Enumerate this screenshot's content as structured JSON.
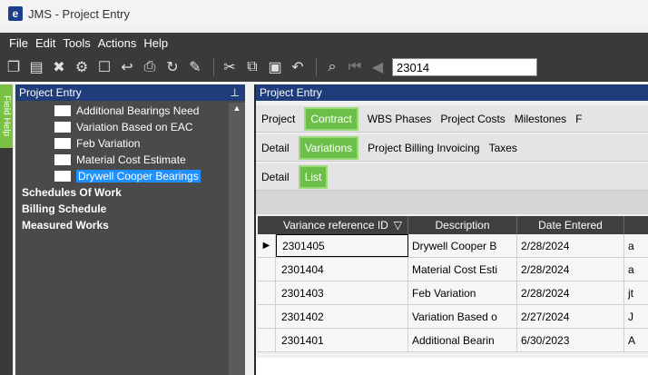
{
  "window": {
    "title": "JMS - Project Entry",
    "logo": "e"
  },
  "menu": [
    "File",
    "Edit",
    "Tools",
    "Actions",
    "Help"
  ],
  "toolbar": {
    "icons": [
      "new-icon",
      "save-icon",
      "delete-icon",
      "tools-icon",
      "blank-icon",
      "undo-arrow-icon",
      "print-icon",
      "refresh-icon",
      "clear-icon",
      "cut-icon",
      "copy-icon",
      "paste-icon",
      "undo-icon",
      "find-icon",
      "first-record-icon",
      "previous-record-icon"
    ],
    "record_value": "23014"
  },
  "side": {
    "field_help": "Field Help"
  },
  "nav": {
    "title": "Project Entry",
    "pin": "⊥",
    "sub_items": [
      {
        "label": "Additional Bearings Need"
      },
      {
        "label": "Variation Based on EAC"
      },
      {
        "label": "Feb Variation"
      },
      {
        "label": "Material Cost Estimate"
      },
      {
        "label": "Drywell Cooper Bearings"
      }
    ],
    "top_items": [
      {
        "label": "Schedules Of Work"
      },
      {
        "label": "Billing Schedule"
      },
      {
        "label": "Measured Works"
      }
    ]
  },
  "main": {
    "title": "Project Entry",
    "tabs_level1": [
      "Project",
      "Contract",
      "WBS Phases",
      "Project Costs",
      "Milestones",
      "F"
    ],
    "tabs_level2": [
      "Detail",
      "Variations",
      "Project Billing Invoicing",
      "Taxes"
    ],
    "tabs_level3": [
      "Detail",
      "List"
    ]
  },
  "grid": {
    "columns": {
      "id": "Variance reference ID",
      "filter": "▽",
      "desc": "Description",
      "date": "Date Entered"
    },
    "rows": [
      {
        "marker": "▶",
        "id": "2301405",
        "desc": "Drywell Cooper B",
        "date": "2/28/2024",
        "more": "a"
      },
      {
        "marker": "",
        "id": "2301404",
        "desc": "Material Cost Esti",
        "date": "2/28/2024",
        "more": "a"
      },
      {
        "marker": "",
        "id": "2301403",
        "desc": "Feb Variation",
        "date": "2/28/2024",
        "more": "jt"
      },
      {
        "marker": "",
        "id": "2301402",
        "desc": "Variation Based o",
        "date": "2/27/2024",
        "more": "J"
      },
      {
        "marker": "",
        "id": "2301401",
        "desc": "Additional Bearin",
        "date": "6/30/2023",
        "more": "A"
      }
    ]
  }
}
